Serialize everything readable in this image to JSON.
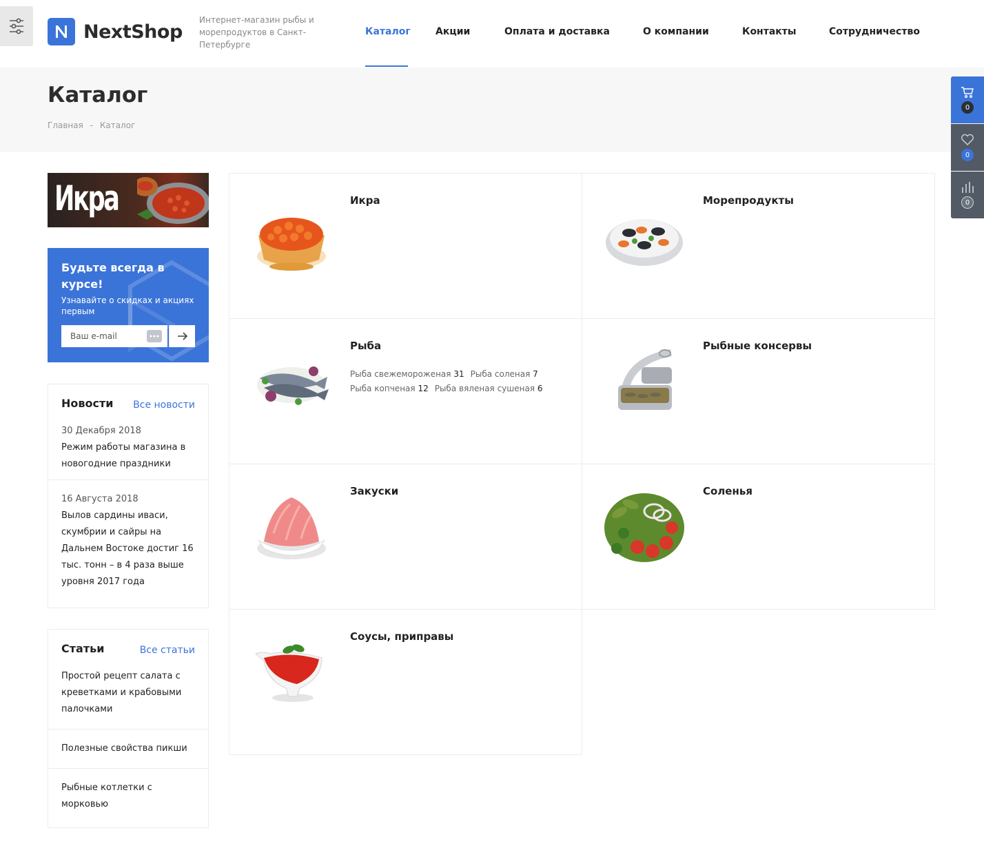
{
  "header": {
    "logo_text": "NextShop",
    "slogan": "Интернет-магазин рыбы и морепродуктов в Санкт-Петербурге",
    "nav": [
      "Каталог",
      "Акции",
      "Оплата и доставка",
      "О компании",
      "Контакты",
      "Сотрудничество"
    ],
    "active_nav": "Каталог"
  },
  "page": {
    "title": "Каталог",
    "breadcrumbs": [
      "Главная",
      "Каталог"
    ],
    "breadcrumb_sep": "-"
  },
  "side_panel": {
    "cart_count": "0",
    "favorites_count": "0",
    "compare_count": "0"
  },
  "sidebar": {
    "banner_text": "Икра",
    "subscribe": {
      "title": "Будьте всегда в курсе!",
      "text": "Узнавайте о скидках и акциях первым",
      "placeholder": "Ваш e-mail"
    },
    "news": {
      "title": "Новости",
      "all_link": "Все новости",
      "items": [
        {
          "date": "30 Декабря 2018",
          "text": "Режим работы магазина в новогодние праздники"
        },
        {
          "date": "16 Августа 2018",
          "text": "Вылов сардины иваси, скумбрии и сайры на Дальнем Востоке достиг 16 тыс. тонн – в 4 раза выше уровня 2017 года"
        }
      ]
    },
    "articles": {
      "title": "Статьи",
      "all_link": "Все статьи",
      "items": [
        "Простой рецепт салата с креветками и крабовыми палочками",
        "Полезные свойства пикши",
        "Рыбные котлетки с морковью"
      ]
    }
  },
  "catalog": [
    {
      "name": "Икра",
      "subs": []
    },
    {
      "name": "Морепродукты",
      "subs": []
    },
    {
      "name": "Рыба",
      "subs": [
        {
          "name": "Рыба свежемороженая",
          "count": "31"
        },
        {
          "name": "Рыба соленая",
          "count": "7"
        },
        {
          "name": "Рыба копченая",
          "count": "12"
        },
        {
          "name": "Рыба вяленая сушеная",
          "count": "6"
        }
      ]
    },
    {
      "name": "Рыбные консервы",
      "subs": []
    },
    {
      "name": "Закуски",
      "subs": []
    },
    {
      "name": "Соленья",
      "subs": []
    },
    {
      "name": "Соусы, приправы",
      "subs": []
    }
  ],
  "colors": {
    "accent": "#3b74d8",
    "panel_dark": "#525a66"
  }
}
